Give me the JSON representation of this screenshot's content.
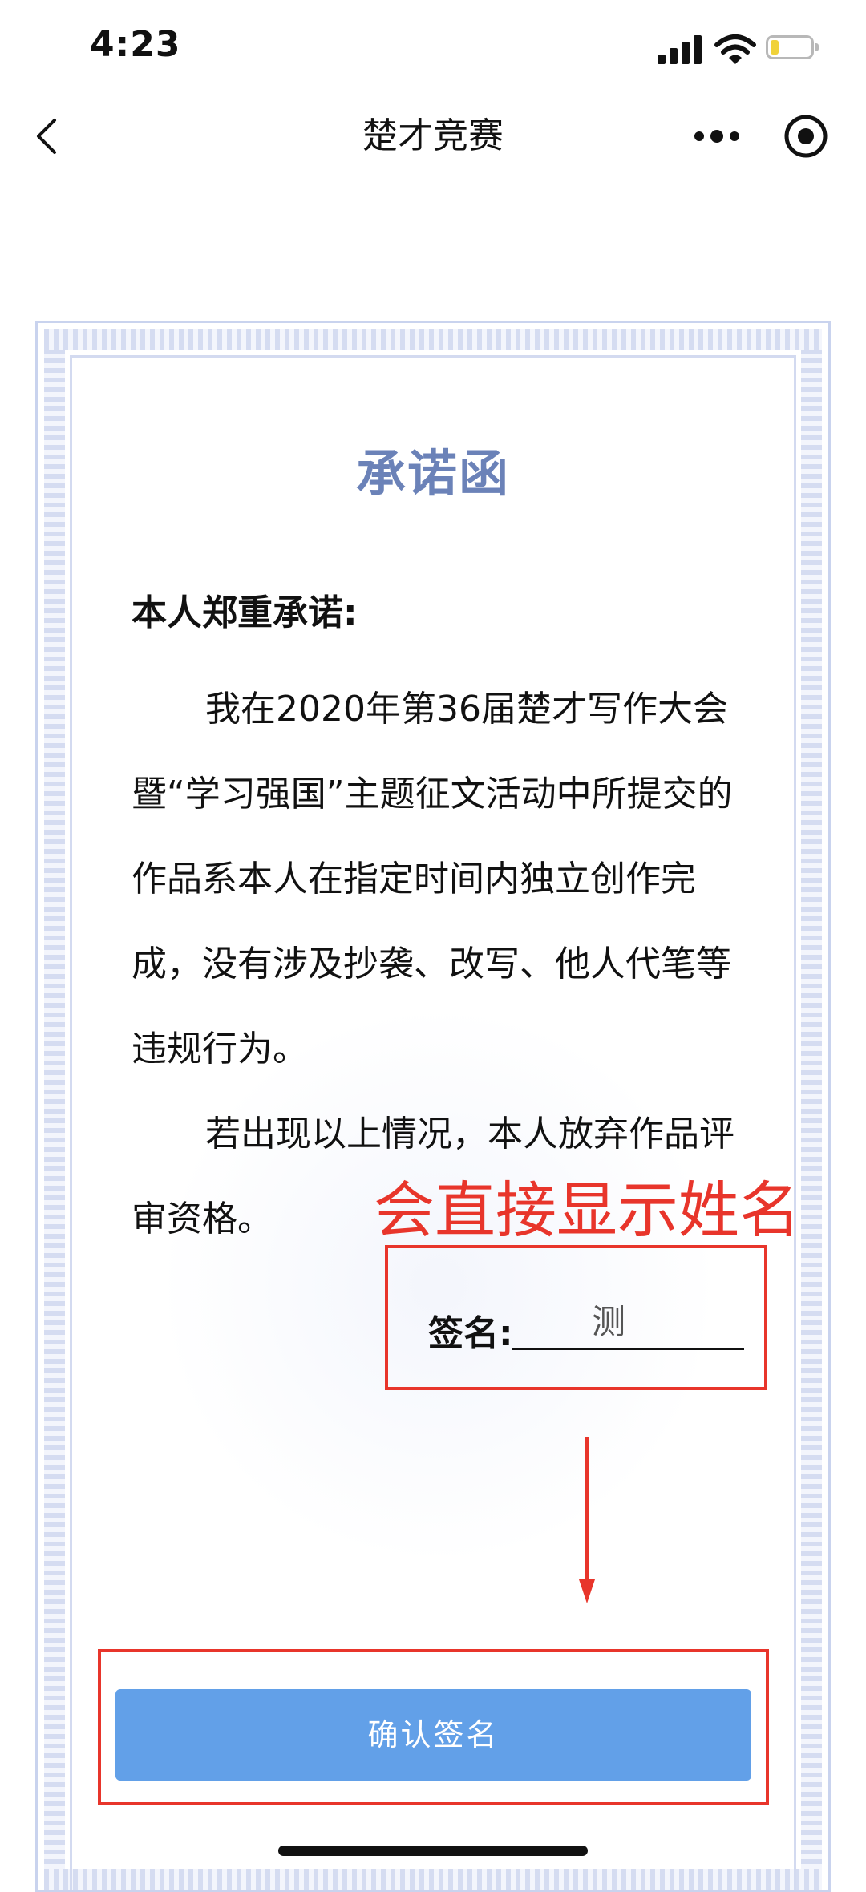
{
  "status_bar": {
    "time": "4:23",
    "icons": [
      "signal-icon",
      "wifi-icon",
      "battery-icon"
    ],
    "battery_level_fraction": 0.2,
    "battery_color": "#f0d23a"
  },
  "nav": {
    "title": "楚才竞赛",
    "icons": [
      "back-icon",
      "more-icon",
      "record-icon"
    ]
  },
  "document": {
    "title": "承诺函",
    "title_color": "#6b82b8",
    "heading": "本人郑重承诺:",
    "paragraphs": [
      "我在2020年第36届楚才写作大会暨“学习强国”主题征文活动中所提交的作品系本人在指定时间内独立创作完成，没有涉及抄袭、改写、他人代笔等违规行为。",
      "若出现以上情况，本人放弃作品评审资格。"
    ],
    "signature_label": "签名:",
    "signature_value": "测"
  },
  "annotation": {
    "text": "会直接显示姓名",
    "color": "#e8352b"
  },
  "confirm": {
    "label": "确认签名",
    "color": "#62a0e8"
  }
}
